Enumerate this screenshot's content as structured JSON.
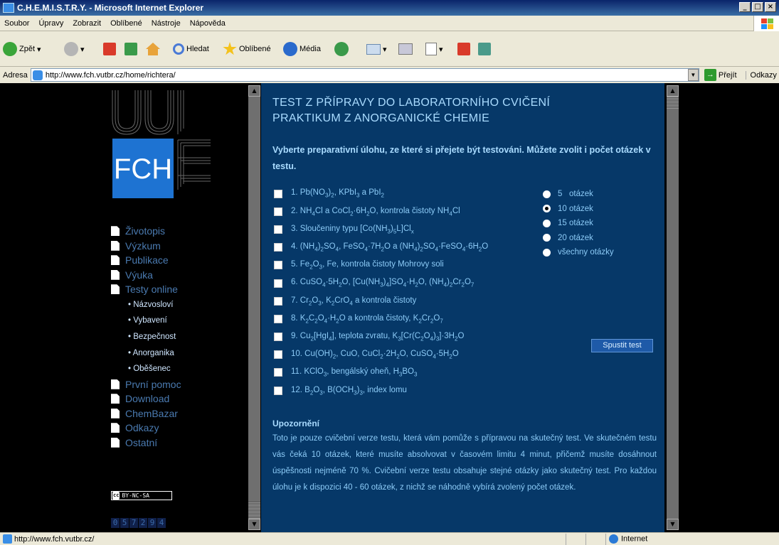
{
  "window": {
    "title": "C.H.E.M.I.S.T.R.Y. - Microsoft Internet Explorer",
    "min": "_",
    "max": "□",
    "close": "×"
  },
  "menu": [
    "Soubor",
    "Úpravy",
    "Zobrazit",
    "Oblíbené",
    "Nástroje",
    "Nápověda"
  ],
  "toolbar": {
    "back": "Zpět",
    "search": "Hledat",
    "favorites": "Oblíbené",
    "media": "Média"
  },
  "address": {
    "label": "Adresa",
    "url": "http://www.fch.vutbr.cz/home/richtera/",
    "go": "Přejít",
    "links": "Odkazy"
  },
  "page": {
    "title_line1": "TEST Z PŘÍPRAVY DO LABORATORNÍHO CVIČENÍ",
    "title_line2": "PRAKTIKUM Z ANORGANICKÉ CHEMIE",
    "intro": "Vyberte preparativní úlohu, ze které si přejete být testováni. Můžete zvolit i počet otázek v testu.",
    "run_button": "Spustit test",
    "warning_title": "Upozornění",
    "warning_text": "Toto je pouze cvičební verze testu, která vám pomůže s přípravou na skutečný test. Ve skutečném testu vás čeká 10 otázek, které musíte absolvovat v časovém limitu 4 minut, přičemž musíte dosáhnout úspěšnosti nejméně 70 %. Cvičební verze testu obsahuje stejné otázky jako skutečný test. Pro každou úlohu je k dispozici 40 - 60 otázek, z nichž se náhodně vybírá zvolený počet otázek."
  },
  "tasks": [
    {
      "parts": [
        [
          "1. Pb(NO",
          ""
        ],
        [
          "3",
          "s"
        ],
        [
          ")",
          ""
        ],
        [
          "2",
          "s"
        ],
        [
          ", KPbI",
          ""
        ],
        [
          "3",
          "s"
        ],
        [
          " a PbI",
          ""
        ],
        [
          "2",
          "s"
        ]
      ]
    },
    {
      "parts": [
        [
          "2. NH",
          ""
        ],
        [
          "4",
          "s"
        ],
        [
          "Cl a CoCl",
          ""
        ],
        [
          "2",
          "s"
        ],
        [
          "·6H",
          ""
        ],
        [
          "2",
          "s"
        ],
        [
          "O, kontrola čistoty NH",
          ""
        ],
        [
          "4",
          "s"
        ],
        [
          "Cl",
          ""
        ]
      ]
    },
    {
      "parts": [
        [
          "3. Sloučeniny typu [Co(NH",
          ""
        ],
        [
          "3",
          "s"
        ],
        [
          ")",
          ""
        ],
        [
          "5",
          "s"
        ],
        [
          "L]Cl",
          ""
        ],
        [
          "x",
          "s"
        ]
      ]
    },
    {
      "parts": [
        [
          "4. (NH",
          ""
        ],
        [
          "4",
          "s"
        ],
        [
          ")",
          ""
        ],
        [
          "2",
          "s"
        ],
        [
          "SO",
          ""
        ],
        [
          "4",
          "s"
        ],
        [
          ", FeSO",
          ""
        ],
        [
          "4",
          "s"
        ],
        [
          "·7H",
          ""
        ],
        [
          "2",
          "s"
        ],
        [
          "O a (NH",
          ""
        ],
        [
          "4",
          "s"
        ],
        [
          ")",
          ""
        ],
        [
          "2",
          "s"
        ],
        [
          "SO",
          ""
        ],
        [
          "4",
          "s"
        ],
        [
          "·FeSO",
          ""
        ],
        [
          "4",
          "s"
        ],
        [
          "·6H",
          ""
        ],
        [
          "2",
          "s"
        ],
        [
          "O",
          ""
        ]
      ]
    },
    {
      "parts": [
        [
          "5. Fe",
          ""
        ],
        [
          "2",
          "s"
        ],
        [
          "O",
          ""
        ],
        [
          "3",
          "s"
        ],
        [
          ", Fe, kontrola čistoty Mohrovy soli",
          ""
        ]
      ]
    },
    {
      "parts": [
        [
          "6. CuSO",
          ""
        ],
        [
          "4",
          "s"
        ],
        [
          "·5H",
          ""
        ],
        [
          "2",
          "s"
        ],
        [
          "O, [Cu(NH",
          ""
        ],
        [
          "3",
          "s"
        ],
        [
          ")",
          ""
        ],
        [
          "4",
          "s"
        ],
        [
          "]SO",
          ""
        ],
        [
          "4",
          "s"
        ],
        [
          "·H",
          ""
        ],
        [
          "2",
          "s"
        ],
        [
          "O, (NH",
          ""
        ],
        [
          "4",
          "s"
        ],
        [
          ")",
          ""
        ],
        [
          "2",
          "s"
        ],
        [
          "Cr",
          ""
        ],
        [
          "2",
          "s"
        ],
        [
          "O",
          ""
        ],
        [
          "7",
          "s"
        ]
      ]
    },
    {
      "parts": [
        [
          "7. Cr",
          ""
        ],
        [
          "2",
          "s"
        ],
        [
          "O",
          ""
        ],
        [
          "3",
          "s"
        ],
        [
          ", K",
          ""
        ],
        [
          "2",
          "s"
        ],
        [
          "CrO",
          ""
        ],
        [
          "4",
          "s"
        ],
        [
          " a kontrola čistoty",
          ""
        ]
      ]
    },
    {
      "parts": [
        [
          "8. K",
          ""
        ],
        [
          "2",
          "s"
        ],
        [
          "C",
          ""
        ],
        [
          "2",
          "s"
        ],
        [
          "O",
          ""
        ],
        [
          "4",
          "s"
        ],
        [
          "·H",
          ""
        ],
        [
          "2",
          "s"
        ],
        [
          "O a kontrola čistoty, K",
          ""
        ],
        [
          "2",
          "s"
        ],
        [
          "Cr",
          ""
        ],
        [
          "2",
          "s"
        ],
        [
          "O",
          ""
        ],
        [
          "7",
          "s"
        ]
      ]
    },
    {
      "parts": [
        [
          "9. Cu",
          ""
        ],
        [
          "2",
          "s"
        ],
        [
          "[HgI",
          ""
        ],
        [
          "4",
          "s"
        ],
        [
          "], teplota zvratu, K",
          ""
        ],
        [
          "3",
          "s"
        ],
        [
          "[Cr(C",
          ""
        ],
        [
          "2",
          "s"
        ],
        [
          "O",
          ""
        ],
        [
          "4",
          "s"
        ],
        [
          ")",
          ""
        ],
        [
          "3",
          "s"
        ],
        [
          "]·3H",
          ""
        ],
        [
          "2",
          "s"
        ],
        [
          "O",
          ""
        ]
      ]
    },
    {
      "parts": [
        [
          "10. Cu(OH)",
          ""
        ],
        [
          "2",
          "s"
        ],
        [
          ", CuO, CuCl",
          ""
        ],
        [
          "2",
          "s"
        ],
        [
          "·2H",
          ""
        ],
        [
          "2",
          "s"
        ],
        [
          "O, CuSO",
          ""
        ],
        [
          "4",
          "s"
        ],
        [
          "·5H",
          ""
        ],
        [
          "2",
          "s"
        ],
        [
          "O",
          ""
        ]
      ]
    },
    {
      "parts": [
        [
          "11. KClO",
          ""
        ],
        [
          "3",
          "s"
        ],
        [
          ", bengálský oheň, H",
          ""
        ],
        [
          "3",
          "s"
        ],
        [
          "BO",
          ""
        ],
        [
          "3",
          "s"
        ]
      ]
    },
    {
      "parts": [
        [
          "12. B",
          ""
        ],
        [
          "2",
          "s"
        ],
        [
          "O",
          ""
        ],
        [
          "3",
          "s"
        ],
        [
          ", B(OCH",
          ""
        ],
        [
          "3",
          "s"
        ],
        [
          ")",
          ""
        ],
        [
          "3",
          "s"
        ],
        [
          ", index lomu",
          ""
        ]
      ]
    }
  ],
  "radios": [
    {
      "label": "5   otázek",
      "checked": false
    },
    {
      "label": "10 otázek",
      "checked": true
    },
    {
      "label": "15 otázek",
      "checked": false
    },
    {
      "label": "20 otázek",
      "checked": false
    },
    {
      "label": "všechny otázky",
      "checked": false
    }
  ],
  "nav": {
    "top": [
      "Životopis",
      "Výzkum",
      "Publikace",
      "Výuka",
      "Testy online"
    ],
    "sub": [
      "• Názvosloví",
      "• Vybavení",
      "• Bezpečnost",
      "• Anorganika",
      "• Oběšenec"
    ],
    "bottom": [
      "První pomoc",
      "Download",
      "ChemBazar",
      "Odkazy",
      "Ostatní"
    ]
  },
  "license": {
    "cc": "cc",
    "text": "BY-NC-SA"
  },
  "counter": [
    "0",
    "5",
    "7",
    "2",
    "9",
    "4"
  ],
  "logo": {
    "text": "FCH"
  },
  "status": {
    "url": "http://www.fch.vutbr.cz/",
    "zone": "Internet"
  }
}
